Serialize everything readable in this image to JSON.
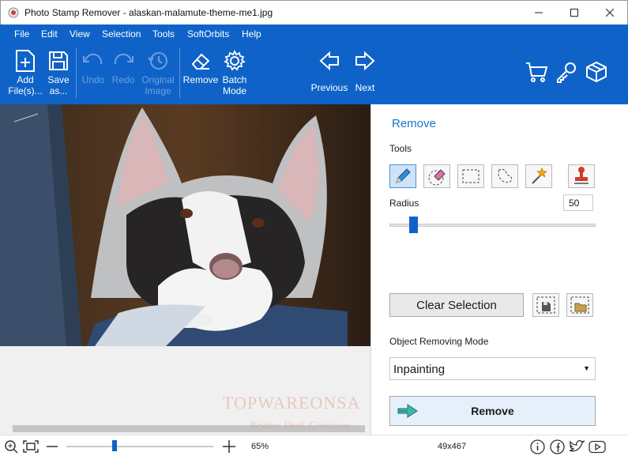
{
  "window": {
    "title": "Photo Stamp Remover - alaskan-malamute-theme-me1.jpg",
    "controls": [
      "minimize",
      "maximize",
      "close"
    ]
  },
  "menu": [
    "File",
    "Edit",
    "View",
    "Selection",
    "Tools",
    "SoftOrbits",
    "Help"
  ],
  "ribbon": {
    "add": "Add\nFile(s)...",
    "save": "Save\nas...",
    "undo": "Undo",
    "redo": "Redo",
    "original": "Original\nImage",
    "remove": "Remove",
    "batch": "Batch\nMode",
    "previous": "Previous",
    "next": "Next"
  },
  "panel": {
    "title": "Remove",
    "tools_label": "Tools",
    "radius_label": "Radius",
    "radius_value": "50",
    "radius_slider_fraction": 0.1,
    "clear_selection": "Clear Selection",
    "mode_label": "Object Removing Mode",
    "mode_value": "Inpainting",
    "remove_button": "Remove"
  },
  "watermark": {
    "line1": "TOPWAREONSA",
    "line2": "Review, Deal, Giveaway"
  },
  "status": {
    "zoom": "65%",
    "dimensions": "49x467",
    "zoom_slider_fraction": 0.32
  },
  "colors": {
    "accent": "#0f63c8",
    "panel_title": "#1a73c8"
  }
}
